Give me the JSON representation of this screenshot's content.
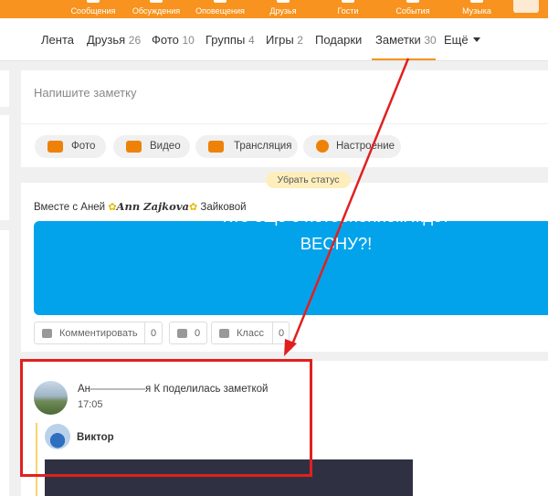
{
  "topbar": {
    "items": [
      {
        "label": "Сообщения",
        "icon": "messages-icon"
      },
      {
        "label": "Обсуждения",
        "icon": "discussions-icon"
      },
      {
        "label": "Оповещения",
        "icon": "notifications-icon"
      },
      {
        "label": "Друзья",
        "icon": "friends-icon"
      },
      {
        "label": "Гости",
        "icon": "guests-icon"
      },
      {
        "label": "События",
        "icon": "events-icon"
      },
      {
        "label": "Музыка",
        "icon": "music-icon"
      }
    ],
    "accent": "#f7931e"
  },
  "nav": {
    "tabs": [
      {
        "label": "Лента",
        "count": ""
      },
      {
        "label": "Друзья",
        "count": "26"
      },
      {
        "label": "Фото",
        "count": "10"
      },
      {
        "label": "Группы",
        "count": "4"
      },
      {
        "label": "Игры",
        "count": "2"
      },
      {
        "label": "Подарки",
        "count": ""
      },
      {
        "label": "Заметки",
        "count": "30"
      },
      {
        "label": "Ещё",
        "count": ""
      }
    ],
    "active": "Заметки"
  },
  "composer": {
    "placeholder": "Напишите заметку",
    "actions": [
      {
        "label": "Фото",
        "icon": "camera-icon"
      },
      {
        "label": "Видео",
        "icon": "video-icon"
      },
      {
        "label": "Трансляция",
        "icon": "broadcast-icon"
      },
      {
        "label": "Настроение",
        "icon": "mood-icon"
      }
    ]
  },
  "status_badge": "Убрать статус",
  "post": {
    "with_prefix": "Вместе с Аней",
    "fancy_name": "Ann Zajkova",
    "with_suffix": "Зайковой",
    "banner_line1": "Кто еще с нетерпением ждет",
    "banner_line2": "ВЕСНУ?!",
    "banner_color": "#03a3ec",
    "comment_label": "Комментировать",
    "comment_count": "0",
    "share_count": "0",
    "like_label": "Класс",
    "like_count": "0"
  },
  "note": {
    "author_start": "Ан",
    "author_end": "я К",
    "action": "поделилась заметкой",
    "time": "17:05",
    "sub_author": "Виктор"
  },
  "annotation": {
    "color": "#e02020"
  }
}
